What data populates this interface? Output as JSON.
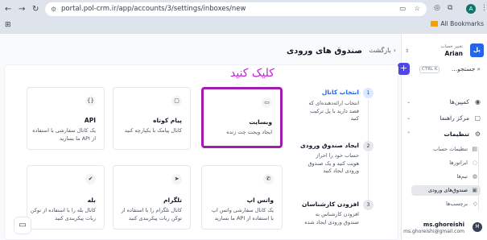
{
  "browser": {
    "url": "portal.pol-crm.ir/app/accounts/3/settings/inboxes/new",
    "bookmarks_label": "All Bookmarks",
    "profile_initial": "A"
  },
  "sidebar": {
    "logo": "پل",
    "account_change": "تغییر حساب",
    "account_name": "Arian",
    "search_label": "جستجو...",
    "shortcut": "CTRL K",
    "items": [
      {
        "label": "کمپین‌ها"
      },
      {
        "label": "مرکز راهنما"
      },
      {
        "label": "تنظیمات"
      }
    ],
    "sub_items": [
      {
        "label": "تنظیمات حساب"
      },
      {
        "label": "ایراتورها"
      },
      {
        "label": "تیم‌ها"
      },
      {
        "label": "صندوق‌های ورودی"
      },
      {
        "label": "برچسب‌ها"
      }
    ],
    "user": {
      "initial": "M",
      "name": "ms.ghoreishi",
      "email": "ms.ghoreishi@gmail.com"
    }
  },
  "header": {
    "back_label": "بازگشت",
    "title": "صندوق های ورودی"
  },
  "annotation": "کلیک کنید",
  "steps": [
    {
      "num": "1",
      "title": "انتخاب کانال",
      "desc": "انتخاب ارائه‌دهنده‌ای که قصد دارید با پل ترکیب کنید"
    },
    {
      "num": "2",
      "title": "ایجاد صندوق ورودی",
      "desc": "حساب خود را احراز هویت کنید و یک صندوق ورودی ایجاد کنید"
    },
    {
      "num": "3",
      "title": "افزودن کارشناسان",
      "desc": "افزودن کارشناس به صندوق ورودی ایجاد شده"
    }
  ],
  "channels": [
    {
      "title": "وبسایت",
      "desc": "ایجاد ویجت چت زنده",
      "icon": "website-chat-icon"
    },
    {
      "title": "پیام کوتاه",
      "desc": "کانال پیامک با یکپارچه کنید",
      "icon": "sms-icon"
    },
    {
      "title": "API",
      "desc": "یک کانال سفارشی با استفاده از API ما بسازید",
      "icon": "code-icon"
    },
    {
      "title": "واتس اپ",
      "desc": "یک کانال سفارشی واتس اپ با استفاده از API ما بسازید",
      "icon": "whatsapp-icon"
    },
    {
      "title": "تلگرام",
      "desc": "کانال تلگرام را با استفاده از توکن ربات پیکربندی کنید",
      "icon": "telegram-icon"
    },
    {
      "title": "بله",
      "desc": "کانال بله را با استفاده از توکن ربات پیکربندی کنید",
      "icon": "bale-icon"
    }
  ],
  "colors": {
    "accent": "#4f46e5",
    "annotation": "#c026d3",
    "selection": "#a21caf"
  }
}
